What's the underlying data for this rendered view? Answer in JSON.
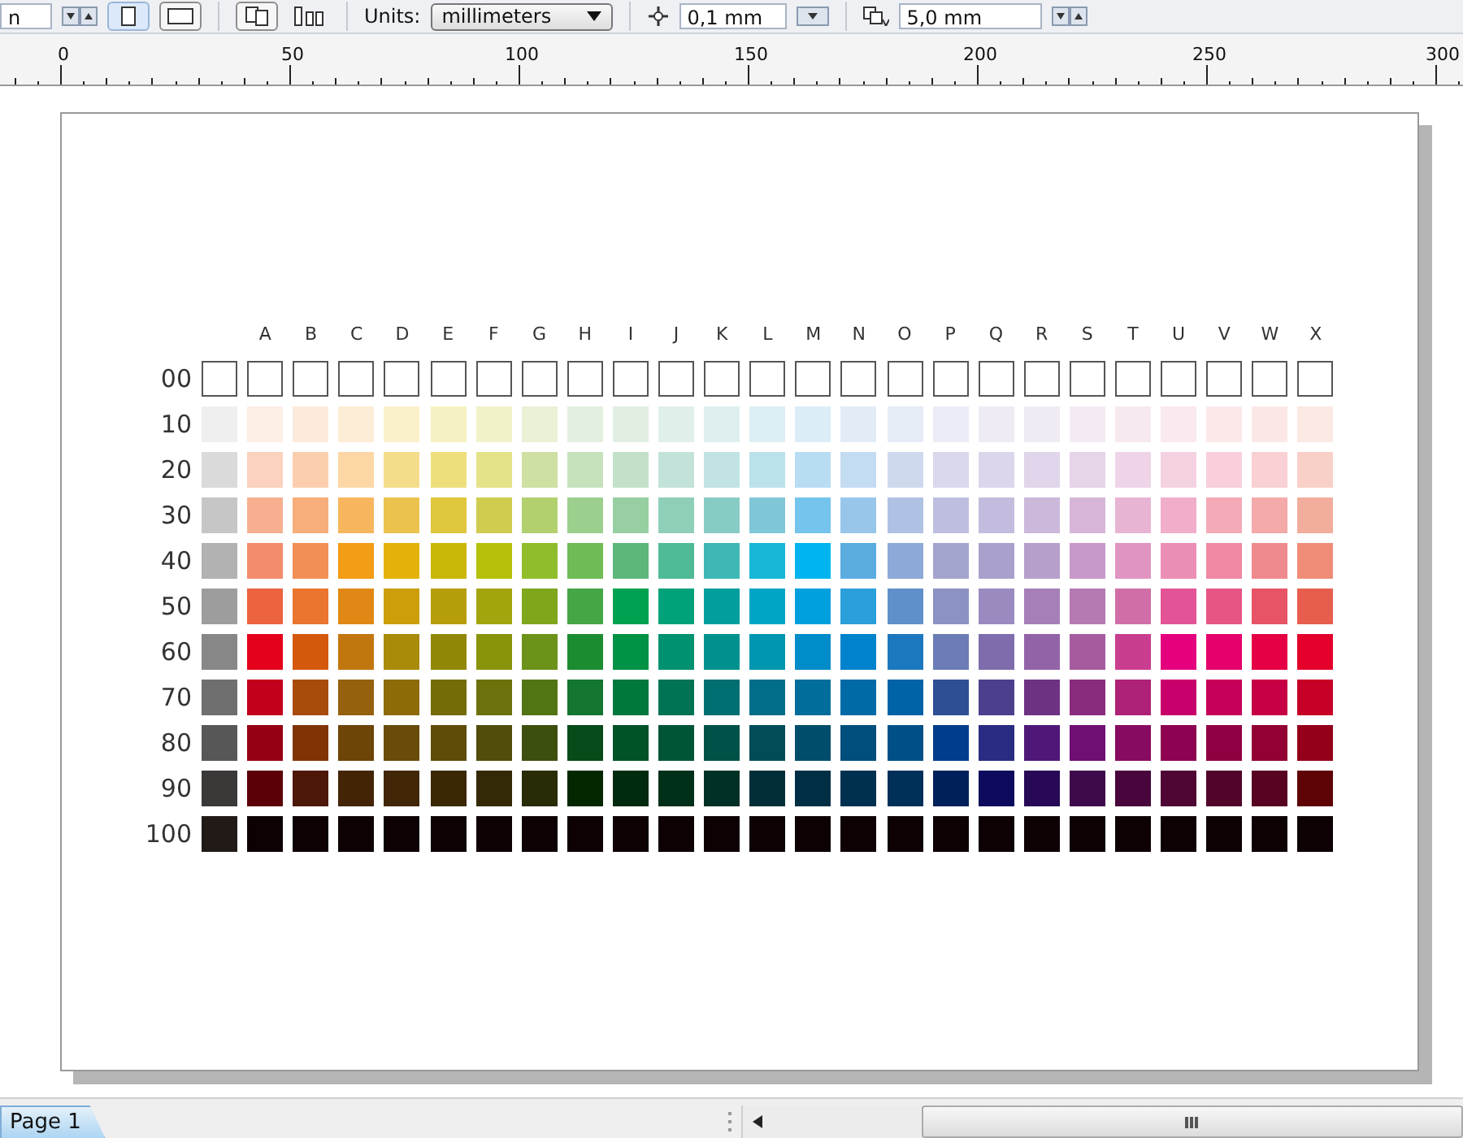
{
  "toolbar": {
    "size_field": "n",
    "units_label": "Units:",
    "units_value": "millimeters",
    "nudge_field": "0,1 mm",
    "duplicate_field": "5,0 mm"
  },
  "ruler": {
    "labels": [
      "0",
      "50",
      "100",
      "150",
      "200",
      "250",
      "300"
    ]
  },
  "columns": [
    "A",
    "B",
    "C",
    "D",
    "E",
    "F",
    "G",
    "H",
    "I",
    "J",
    "K",
    "L",
    "M",
    "N",
    "O",
    "P",
    "Q",
    "R",
    "S",
    "T",
    "U",
    "V",
    "W",
    "X"
  ],
  "rows": [
    {
      "label": "00",
      "kind": "outline",
      "cells": [
        {
          "color": "#ffffff"
        },
        {
          "color": "#ffffff"
        },
        {
          "color": "#ffffff"
        },
        {
          "color": "#ffffff"
        },
        {
          "color": "#ffffff"
        },
        {
          "color": "#ffffff"
        },
        {
          "color": "#ffffff"
        },
        {
          "color": "#ffffff"
        },
        {
          "color": "#ffffff"
        },
        {
          "color": "#ffffff"
        },
        {
          "color": "#ffffff"
        },
        {
          "color": "#ffffff"
        },
        {
          "color": "#ffffff"
        },
        {
          "color": "#ffffff"
        },
        {
          "color": "#ffffff"
        },
        {
          "color": "#ffffff"
        },
        {
          "color": "#ffffff"
        },
        {
          "color": "#ffffff"
        },
        {
          "color": "#ffffff"
        },
        {
          "color": "#ffffff"
        },
        {
          "color": "#ffffff"
        },
        {
          "color": "#ffffff"
        },
        {
          "color": "#ffffff"
        },
        {
          "color": "#ffffff"
        },
        {
          "color": "#ffffff"
        }
      ]
    },
    {
      "label": "10",
      "kind": "filled",
      "cells": [
        {
          "color": "#efefef"
        },
        {
          "color": "#fdeee6"
        },
        {
          "color": "#fdeadb"
        },
        {
          "color": "#fdecd6"
        },
        {
          "color": "#faf0c9"
        },
        {
          "color": "#f6f1c3"
        },
        {
          "color": "#f2f2c8"
        },
        {
          "color": "#eaf1d5"
        },
        {
          "color": "#e4f0df"
        },
        {
          "color": "#e1efe3"
        },
        {
          "color": "#e0efe9"
        },
        {
          "color": "#dfeff0"
        },
        {
          "color": "#ddeef4"
        },
        {
          "color": "#dcedf8"
        },
        {
          "color": "#e1ecf7"
        },
        {
          "color": "#e6ecf6"
        },
        {
          "color": "#ebecf6"
        },
        {
          "color": "#eeebf5"
        },
        {
          "color": "#f0eaf4"
        },
        {
          "color": "#f3eaf3"
        },
        {
          "color": "#f7e9f0"
        },
        {
          "color": "#fae9ee"
        },
        {
          "color": "#fbe9ea"
        },
        {
          "color": "#fbe8e6"
        },
        {
          "color": "#fbe9e3"
        }
      ]
    },
    {
      "label": "20",
      "kind": "filled",
      "cells": [
        {
          "color": "#dadada"
        },
        {
          "color": "#fbd2bd"
        },
        {
          "color": "#fbcfae"
        },
        {
          "color": "#fcd7a5"
        },
        {
          "color": "#f4dd8a"
        },
        {
          "color": "#ede07c"
        },
        {
          "color": "#e4e38a"
        },
        {
          "color": "#cfe0a3"
        },
        {
          "color": "#c6e2bd"
        },
        {
          "color": "#c3e1c9"
        },
        {
          "color": "#c3e2d9"
        },
        {
          "color": "#c1e3e1"
        },
        {
          "color": "#bbe2ea"
        },
        {
          "color": "#b8ddf3"
        },
        {
          "color": "#c4dcf2"
        },
        {
          "color": "#cfd9ee"
        },
        {
          "color": "#d9d8ed"
        },
        {
          "color": "#dcd6ec"
        },
        {
          "color": "#e0d5ea"
        },
        {
          "color": "#e6d4e9"
        },
        {
          "color": "#efd4e8"
        },
        {
          "color": "#f5d2e2"
        },
        {
          "color": "#f8cfda"
        },
        {
          "color": "#f9d0d4"
        },
        {
          "color": "#f8d0c7"
        }
      ]
    },
    {
      "label": "30",
      "kind": "filled",
      "cells": [
        {
          "color": "#c6c6c6"
        },
        {
          "color": "#f6b08f"
        },
        {
          "color": "#f7ae7a"
        },
        {
          "color": "#f7b65d"
        },
        {
          "color": "#ecc24f"
        },
        {
          "color": "#dfc63c"
        },
        {
          "color": "#cfcc4f"
        },
        {
          "color": "#b2d06e"
        },
        {
          "color": "#9ccf8d"
        },
        {
          "color": "#97cfa3"
        },
        {
          "color": "#8fcfb8"
        },
        {
          "color": "#87cbc5"
        },
        {
          "color": "#7fc6d7"
        },
        {
          "color": "#74c4ee"
        },
        {
          "color": "#98c6ea"
        },
        {
          "color": "#afc2e4"
        },
        {
          "color": "#bebfe0"
        },
        {
          "color": "#c4bcde"
        },
        {
          "color": "#ccb8db"
        },
        {
          "color": "#d6b5d8"
        },
        {
          "color": "#e8b4d4"
        },
        {
          "color": "#f1aecb"
        },
        {
          "color": "#f5aab8"
        },
        {
          "color": "#f3aaa8"
        },
        {
          "color": "#f2ad9c"
        }
      ]
    },
    {
      "label": "40",
      "kind": "filled",
      "cells": [
        {
          "color": "#b2b2b2"
        },
        {
          "color": "#f28c6c"
        },
        {
          "color": "#f28f54"
        },
        {
          "color": "#f39c16"
        },
        {
          "color": "#e2b20b"
        },
        {
          "color": "#cbb707"
        },
        {
          "color": "#b6c10a"
        },
        {
          "color": "#8fbd2b"
        },
        {
          "color": "#6fbb55"
        },
        {
          "color": "#5db67a"
        },
        {
          "color": "#4fba96"
        },
        {
          "color": "#3db8b5"
        },
        {
          "color": "#17b7d7"
        },
        {
          "color": "#00b5ef"
        },
        {
          "color": "#5bade0"
        },
        {
          "color": "#8da9d7"
        },
        {
          "color": "#a3a5cf"
        },
        {
          "color": "#aaa0cc"
        },
        {
          "color": "#b79fcc"
        },
        {
          "color": "#c799c8"
        },
        {
          "color": "#e094c1"
        },
        {
          "color": "#eb8eb6"
        },
        {
          "color": "#ef89a3"
        },
        {
          "color": "#ef8a8f"
        },
        {
          "color": "#ef8d79"
        }
      ]
    },
    {
      "label": "50",
      "kind": "filled",
      "cells": [
        {
          "color": "#9d9d9d"
        },
        {
          "color": "#ec6340"
        },
        {
          "color": "#e9752f"
        },
        {
          "color": "#e08816"
        },
        {
          "color": "#cd9e08"
        },
        {
          "color": "#b69e0a"
        },
        {
          "color": "#a2a50d"
        },
        {
          "color": "#80a61c"
        },
        {
          "color": "#45a646"
        },
        {
          "color": "#00a251"
        },
        {
          "color": "#00a27a"
        },
        {
          "color": "#009f9d"
        },
        {
          "color": "#00a5c5"
        },
        {
          "color": "#00a0df"
        },
        {
          "color": "#2b9fd9"
        },
        {
          "color": "#5f90ca"
        },
        {
          "color": "#8c92c4"
        },
        {
          "color": "#9b8ac0"
        },
        {
          "color": "#a67fb8"
        },
        {
          "color": "#b57ab1"
        },
        {
          "color": "#d06ea8"
        },
        {
          "color": "#e35497"
        },
        {
          "color": "#e65584"
        },
        {
          "color": "#e65465"
        },
        {
          "color": "#e75e4e"
        }
      ]
    },
    {
      "label": "60",
      "kind": "filled",
      "cells": [
        {
          "color": "#878787"
        },
        {
          "color": "#e5001b"
        },
        {
          "color": "#d5590d"
        },
        {
          "color": "#c2770e"
        },
        {
          "color": "#aa8a09"
        },
        {
          "color": "#918707"
        },
        {
          "color": "#8a940b"
        },
        {
          "color": "#6c921a"
        },
        {
          "color": "#1c8c31"
        },
        {
          "color": "#009245"
        },
        {
          "color": "#009170"
        },
        {
          "color": "#00918e"
        },
        {
          "color": "#0096b0"
        },
        {
          "color": "#008bc9"
        },
        {
          "color": "#0082cc"
        },
        {
          "color": "#1c78be"
        },
        {
          "color": "#6b7cb6"
        },
        {
          "color": "#7e6cad"
        },
        {
          "color": "#9363a7"
        },
        {
          "color": "#a55b9e"
        },
        {
          "color": "#c93d8e"
        },
        {
          "color": "#e5007e"
        },
        {
          "color": "#e5006c"
        },
        {
          "color": "#e50045"
        },
        {
          "color": "#e4002b"
        }
      ]
    },
    {
      "label": "70",
      "kind": "filled",
      "cells": [
        {
          "color": "#6f6f6f"
        },
        {
          "color": "#c2001c"
        },
        {
          "color": "#a84c0c"
        },
        {
          "color": "#95610c"
        },
        {
          "color": "#8d6b06"
        },
        {
          "color": "#746c07"
        },
        {
          "color": "#6b720c"
        },
        {
          "color": "#527514"
        },
        {
          "color": "#137530"
        },
        {
          "color": "#00773d"
        },
        {
          "color": "#007354"
        },
        {
          "color": "#006f71"
        },
        {
          "color": "#006e88"
        },
        {
          "color": "#006d9a"
        },
        {
          "color": "#006aa6"
        },
        {
          "color": "#0062a7"
        },
        {
          "color": "#2f4f95"
        },
        {
          "color": "#4c3f8d"
        },
        {
          "color": "#6e3283"
        },
        {
          "color": "#8a2c7d"
        },
        {
          "color": "#ad2176"
        },
        {
          "color": "#c8006c"
        },
        {
          "color": "#c6005a"
        },
        {
          "color": "#c60044"
        },
        {
          "color": "#c60026"
        }
      ]
    },
    {
      "label": "80",
      "kind": "filled",
      "cells": [
        {
          "color": "#575757"
        },
        {
          "color": "#960014"
        },
        {
          "color": "#803406"
        },
        {
          "color": "#6d4506"
        },
        {
          "color": "#694b0a"
        },
        {
          "color": "#5e4c08"
        },
        {
          "color": "#524d0a"
        },
        {
          "color": "#3d4f0f"
        },
        {
          "color": "#064b19"
        },
        {
          "color": "#005227"
        },
        {
          "color": "#005537"
        },
        {
          "color": "#005147"
        },
        {
          "color": "#004d58"
        },
        {
          "color": "#004c6b"
        },
        {
          "color": "#004e7c"
        },
        {
          "color": "#005087"
        },
        {
          "color": "#003d8a"
        },
        {
          "color": "#2a2b82"
        },
        {
          "color": "#4f1878"
        },
        {
          "color": "#6f0f75"
        },
        {
          "color": "#870b61"
        },
        {
          "color": "#8d0352"
        },
        {
          "color": "#8f0042"
        },
        {
          "color": "#930033"
        },
        {
          "color": "#940019"
        }
      ]
    },
    {
      "label": "90",
      "kind": "filled",
      "cells": [
        {
          "color": "#3b3838"
        },
        {
          "color": "#5c0008"
        },
        {
          "color": "#4d1808"
        },
        {
          "color": "#432406"
        },
        {
          "color": "#412707"
        },
        {
          "color": "#3c2705"
        },
        {
          "color": "#342907"
        },
        {
          "color": "#292c06"
        },
        {
          "color": "#042700"
        },
        {
          "color": "#002b0f"
        },
        {
          "color": "#003019"
        },
        {
          "color": "#003026"
        },
        {
          "color": "#002f3a"
        },
        {
          "color": "#002f45"
        },
        {
          "color": "#003050"
        },
        {
          "color": "#003058"
        },
        {
          "color": "#00205b"
        },
        {
          "color": "#0d0a5e"
        },
        {
          "color": "#280957"
        },
        {
          "color": "#3f0a4c"
        },
        {
          "color": "#48063c"
        },
        {
          "color": "#4f0635"
        },
        {
          "color": "#52042b"
        },
        {
          "color": "#590322"
        },
        {
          "color": "#5e0306"
        }
      ]
    },
    {
      "label": "100",
      "kind": "filled",
      "cells": [
        {
          "color": "#211a17"
        },
        {
          "color": "#0d0103"
        },
        {
          "color": "#0d0103"
        },
        {
          "color": "#0d0103"
        },
        {
          "color": "#0d0103"
        },
        {
          "color": "#0d0103"
        },
        {
          "color": "#0d0103"
        },
        {
          "color": "#0d0103"
        },
        {
          "color": "#0d0103"
        },
        {
          "color": "#0d0103"
        },
        {
          "color": "#0d0103"
        },
        {
          "color": "#0d0103"
        },
        {
          "color": "#0d0103"
        },
        {
          "color": "#0d0103"
        },
        {
          "color": "#0d0103"
        },
        {
          "color": "#0d0103"
        },
        {
          "color": "#0d0103"
        },
        {
          "color": "#0d0103"
        },
        {
          "color": "#0d0103"
        },
        {
          "color": "#0d0103"
        },
        {
          "color": "#0d0103"
        },
        {
          "color": "#0d0103"
        },
        {
          "color": "#0d0103"
        },
        {
          "color": "#0d0103"
        },
        {
          "color": "#0d0103"
        }
      ]
    }
  ],
  "page_tabs": [
    {
      "label": "Page 1",
      "selected": true
    }
  ]
}
